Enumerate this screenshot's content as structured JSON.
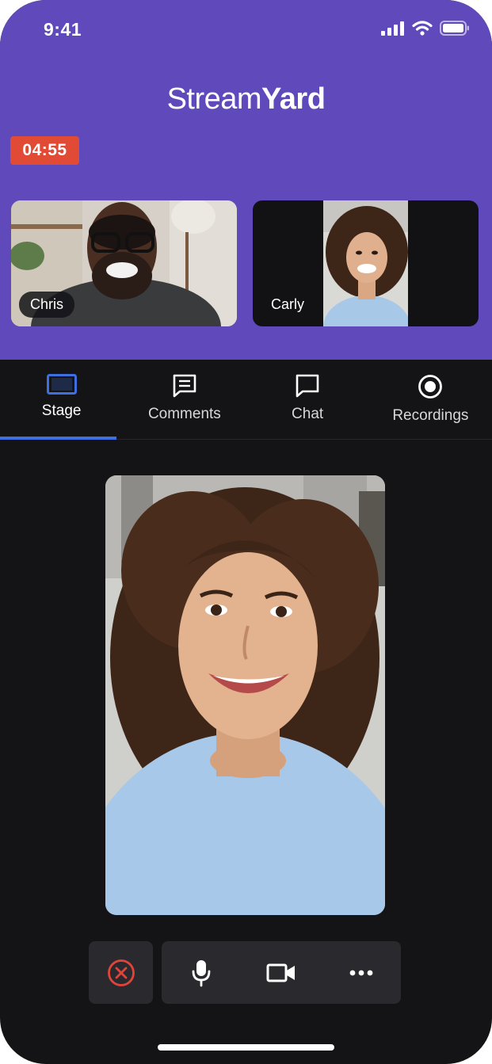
{
  "status_bar": {
    "time": "9:41",
    "icons": [
      "signal-icon",
      "wifi-icon",
      "battery-icon"
    ]
  },
  "header": {
    "brand_light": "Stream",
    "brand_bold": "Yard",
    "timer": "04:55",
    "brand_color": "#5f49bb",
    "timer_color": "#e14a35"
  },
  "participants": [
    {
      "name": "Chris"
    },
    {
      "name": "Carly"
    }
  ],
  "tabs": [
    {
      "label": "Stage",
      "icon": "stage-icon",
      "active": true
    },
    {
      "label": "Comments",
      "icon": "comments-icon",
      "active": false
    },
    {
      "label": "Chat",
      "icon": "chat-icon",
      "active": false
    },
    {
      "label": "Recordings",
      "icon": "recordings-icon",
      "active": false
    }
  ],
  "tab_accent": "#3d6fe0",
  "controls": [
    {
      "icon": "leave-icon"
    },
    {
      "icon": "microphone-icon"
    },
    {
      "icon": "camera-icon"
    },
    {
      "icon": "more-icon"
    }
  ]
}
